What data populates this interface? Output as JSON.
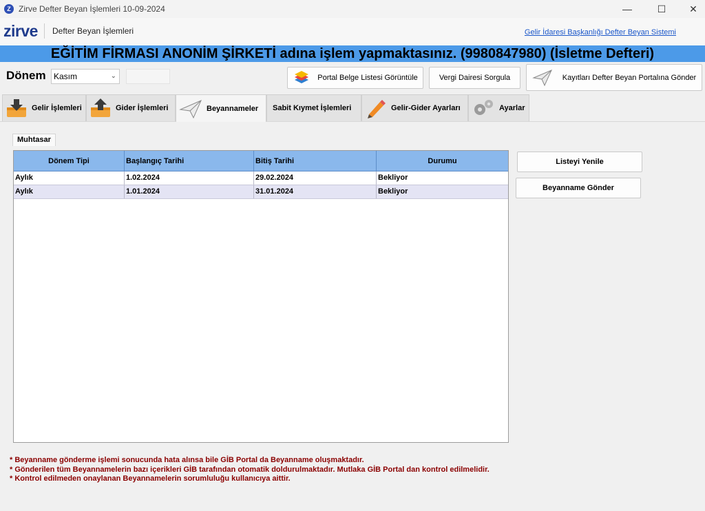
{
  "window": {
    "app_icon": "Z",
    "title": "Zirve Defter Beyan İşlemleri 10-09-2024",
    "minimize": "—",
    "maximize": "☐",
    "close": "✕"
  },
  "header": {
    "logo": "zirve",
    "title": "Defter Beyan İşlemleri",
    "link": "Gelir İdaresi Başkanlığı Defter Beyan Sistemi"
  },
  "banner": "EĞİTİM FİRMASI ANONİM ŞİRKETİ adına işlem yapmaktasınız. (9980847980) (İsletme Defteri)",
  "period": {
    "label": "Dönem",
    "value": "Kasım"
  },
  "toolbar": {
    "portal_list": "Portal Belge Listesi Görüntüle",
    "tax_office": "Vergi Dairesi Sorgula",
    "send_records": "Kayıtları Defter Beyan Portalına Gönder"
  },
  "tabs": [
    {
      "label": "Gelir İşlemleri",
      "icon": "download-box-icon"
    },
    {
      "label": "Gider İşlemleri",
      "icon": "upload-box-icon"
    },
    {
      "label": "Beyannameler",
      "icon": "paper-plane-icon"
    },
    {
      "label": "Sabit Kıymet İşlemleri",
      "icon": ""
    },
    {
      "label": "Gelir-Gider Ayarları",
      "icon": "pencil-icon"
    },
    {
      "label": "Ayarlar",
      "icon": "gears-icon"
    }
  ],
  "subtab": "Muhtasar",
  "table": {
    "columns": [
      "Dönem Tipi",
      "Başlangıç Tarihi",
      "Bitiş Tarihi",
      "Durumu"
    ],
    "rows": [
      [
        "Aylık",
        "1.02.2024",
        "29.02.2024",
        "Bekliyor"
      ],
      [
        "Aylık",
        "1.01.2024",
        "31.01.2024",
        "Bekliyor"
      ]
    ]
  },
  "side_buttons": {
    "refresh": "Listeyi Yenile",
    "send": "Beyanname Gönder"
  },
  "notes": [
    "* Beyanname gönderme işlemi sonucunda hata alınsa bile GİB Portal da Beyanname oluşmaktadır.",
    "* Gönderilen tüm Beyannamelerin bazı içerikleri GİB tarafından otomatik doldurulmaktadır. Mutlaka GİB Portal dan kontrol edilmelidir.",
    "* Kontrol edilmeden onaylanan Beyannamelerin sorumluluğu kullanıcıya aittir."
  ],
  "colors": {
    "banner": "#4c9ae8",
    "grid_header": "#8ab8ec",
    "row_alt": "#e4e4f4",
    "note_text": "#8b0000"
  }
}
